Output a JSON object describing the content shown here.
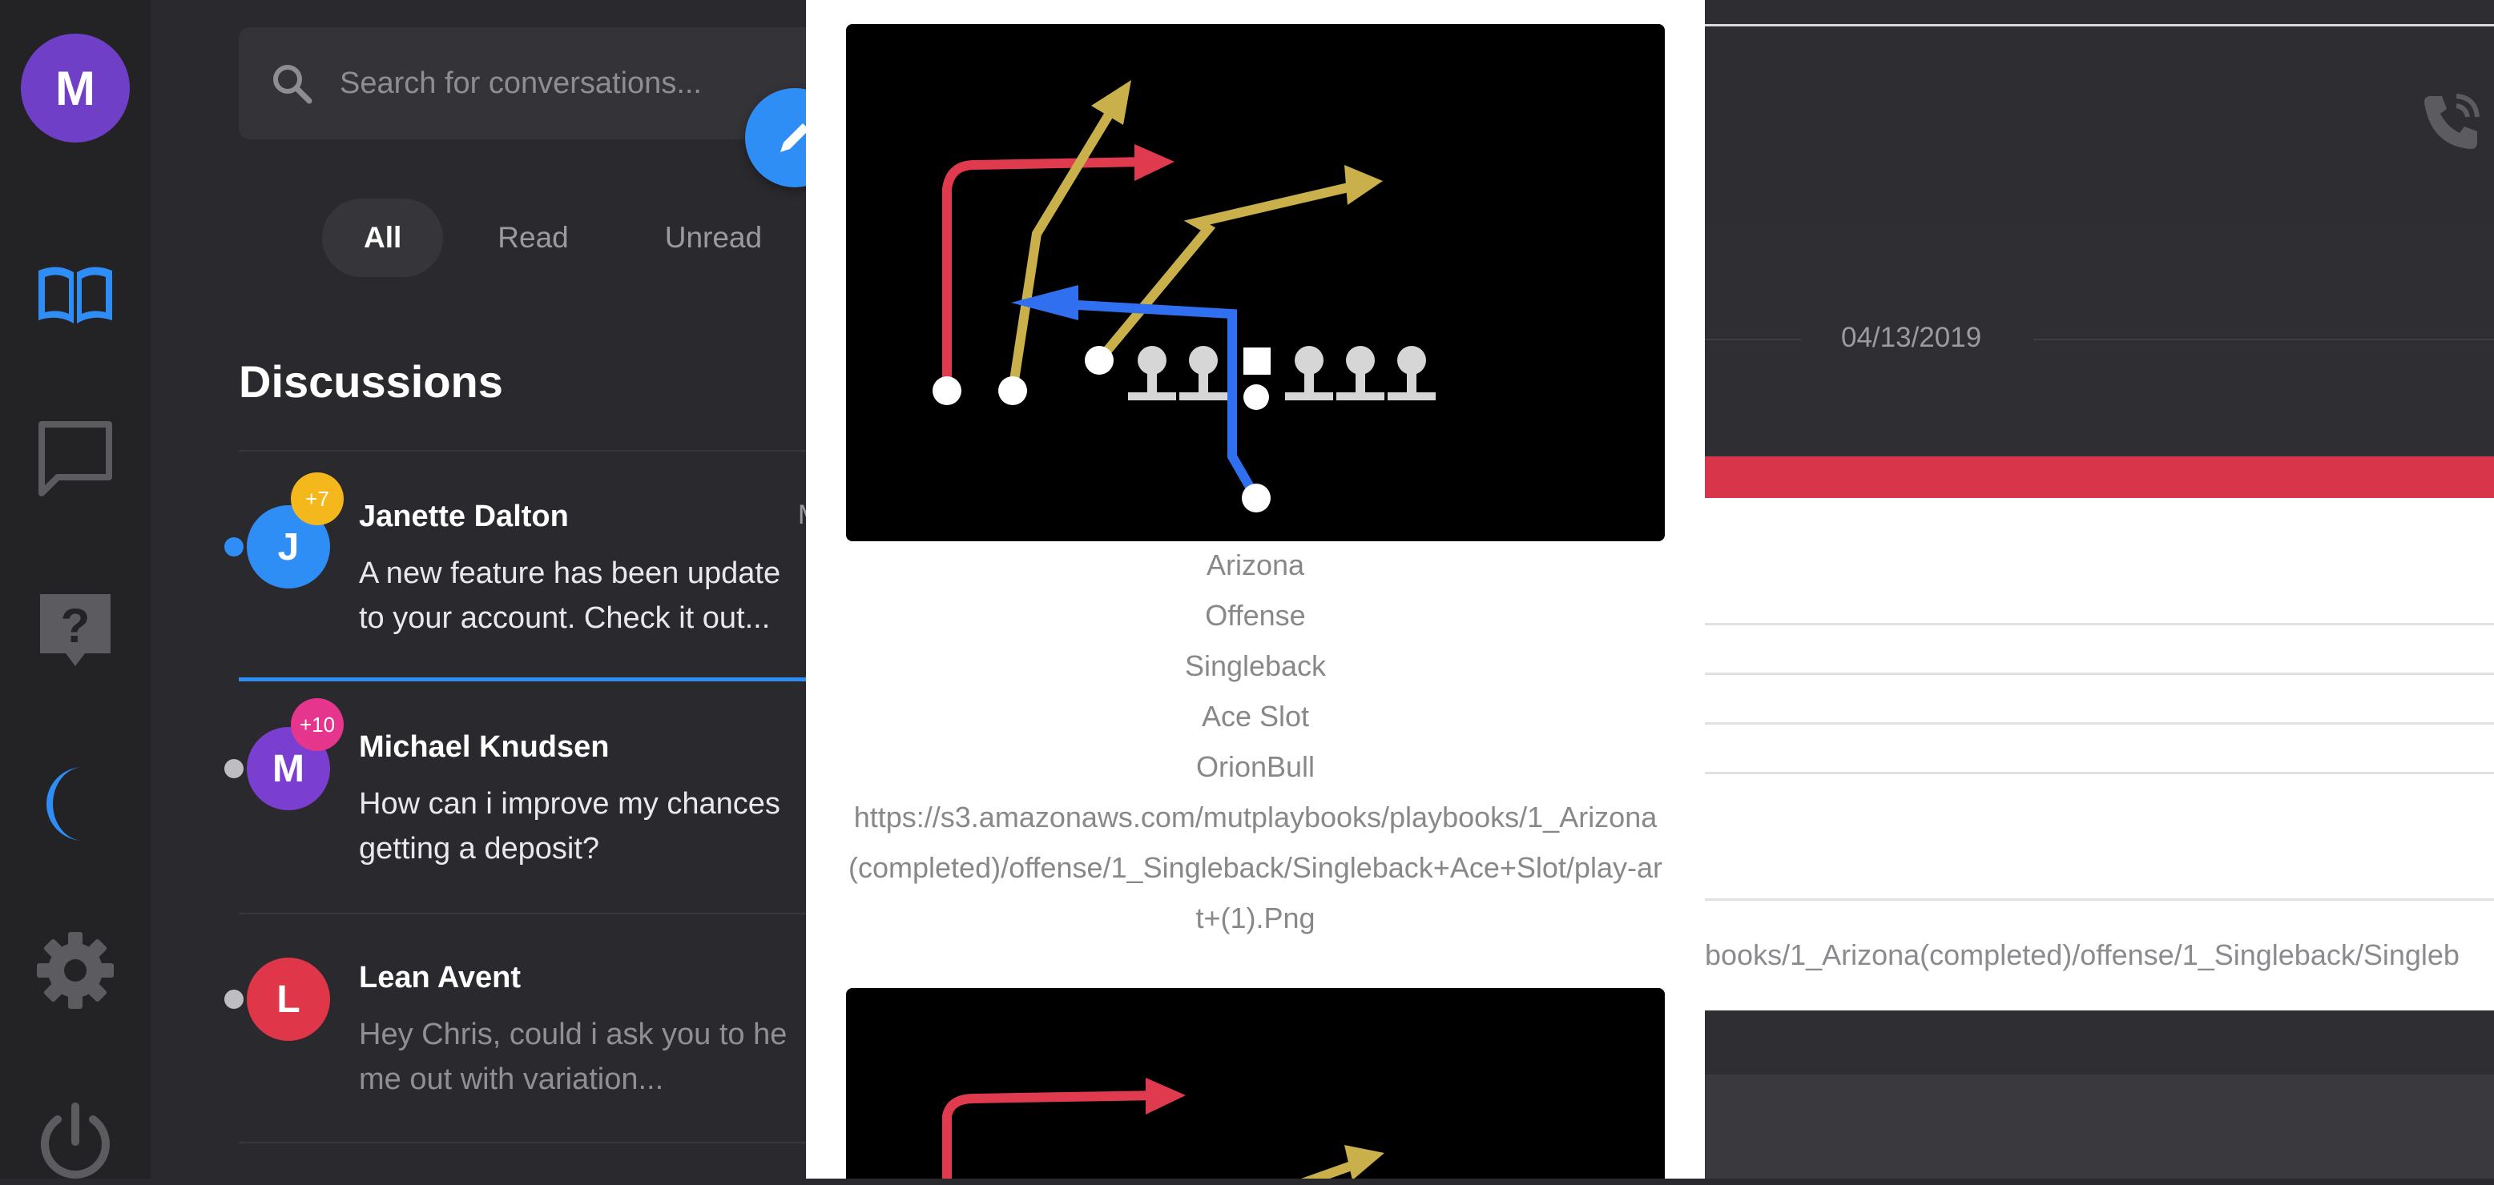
{
  "user": {
    "initial": "M",
    "color": "#6f3fc8"
  },
  "rail": {
    "items": [
      {
        "name": "book-icon",
        "active": true
      },
      {
        "name": "chat-icon"
      },
      {
        "name": "help-icon"
      },
      {
        "name": "moon-icon"
      },
      {
        "name": "gear-icon"
      },
      {
        "name": "power-icon"
      }
    ]
  },
  "search": {
    "placeholder": "Search for conversations..."
  },
  "filters": {
    "all": "All",
    "read": "Read",
    "unread": "Unread"
  },
  "discussions": {
    "title": "Discussions",
    "items": [
      {
        "initial": "J",
        "name": "Janette Dalton",
        "badge": "+7",
        "badge_color": "#f5b81c",
        "avatar_color": "#2f8ef5",
        "status": "online",
        "message_1": "A new feature has been update",
        "message_2": "to your account. Check it out...",
        "time_fragment": "M"
      },
      {
        "initial": "M",
        "name": "Michael Knudsen",
        "badge": "+10",
        "badge_color": "#e6358c",
        "avatar_color": "#7a3fd0",
        "status": "offline",
        "message_1": "How can i improve my chances",
        "message_2": "getting a deposit?"
      },
      {
        "initial": "L",
        "name": "Lean Avent",
        "avatar_color": "#e0364a",
        "status": "offline",
        "message_1": "Hey Chris, could i ask you to he",
        "message_2": "me out with variation..."
      }
    ]
  },
  "chat": {
    "date": "04/13/2019",
    "url_fragment": "books/1_Arizona(completed)/offense/1_Singleback/Singleb"
  },
  "modal": {
    "caption": {
      "team": "Arizona",
      "side": "Offense",
      "formation": "Singleback",
      "set": "Ace Slot",
      "play": "OrionBull",
      "url": "https://s3.amazonaws.com/mutplaybooks/playbooks/1_Arizona(completed)/offense/1_Singleback/Singleback+Ace+Slot/play-art+(1).Png"
    }
  },
  "colors": {
    "accent": "#2f8ef5",
    "route_red": "#e03a4e",
    "route_gold": "#c9b04a",
    "route_blue": "#2f6ff0"
  }
}
